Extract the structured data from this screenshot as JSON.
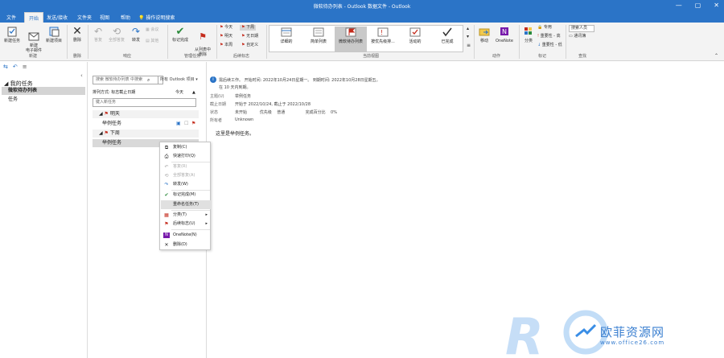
{
  "window": {
    "title": "微软待办列表 - Outlook 数据文件 - Outlook",
    "controls": [
      "—",
      "▢",
      "✕"
    ]
  },
  "menu": {
    "tabs": [
      "文件",
      "开始",
      "发送/接收",
      "文件夹",
      "视图",
      "帮助"
    ],
    "active_index": 1,
    "tell_me": "操作说明搜索"
  },
  "ribbon": {
    "new_group": {
      "label": "新建",
      "new_task": "新建任务",
      "new_email": "新建\n电子邮件",
      "new_items": "新建项目"
    },
    "delete_group": {
      "label": "删除",
      "delete": "删除"
    },
    "respond_group": {
      "label": "响应",
      "reply": "答复",
      "reply_all": "全部答复",
      "forward": "转发",
      "meeting": "会议",
      "more": "其他"
    },
    "manage_group": {
      "label": "管理任务",
      "mark_complete": "标记完成",
      "remove_from_list": "从列表中\n删除"
    },
    "followup_group": {
      "label": "后续标志",
      "items": [
        "今天",
        "明天",
        "本周",
        "下周",
        "无日期",
        "自定义"
      ]
    },
    "view_group": {
      "label": "当前视图",
      "views": [
        "详细的",
        "简单列表",
        "微软待办列表",
        "按优先级排...",
        "活动的",
        "已完成"
      ],
      "selected_index": 2
    },
    "actions_group": {
      "label": "动作",
      "move": "移动",
      "onenote": "OneNote"
    },
    "tags_group": {
      "label": "标记",
      "categorize": "分类",
      "private": "专用",
      "high": "重要性 - 高",
      "low": "重要性 - 低"
    },
    "find_group": {
      "label": "查找",
      "search_people": "搜索人员",
      "address_book": "通讯簿"
    }
  },
  "nav": {
    "header": "我的任务",
    "items": [
      "微软待办列表",
      "任务"
    ],
    "selected_index": 0
  },
  "list": {
    "search_placeholder": "搜索 微软待办列表 中搜索",
    "search_scope": "所有 Outlook 项目",
    "sort_label": "排列方式: 标志截止日期",
    "sort_value": "今天",
    "new_task_placeholder": "键入新任务",
    "groups": [
      {
        "name": "明天",
        "tasks": [
          "举例任务"
        ]
      },
      {
        "name": "下周",
        "tasks": [
          "举例任务"
        ]
      }
    ]
  },
  "context_menu": {
    "items": [
      {
        "label": "复制(C)",
        "icon": "copy-icon",
        "enabled": true
      },
      {
        "label": "快速打印(Q)",
        "icon": "print-icon",
        "enabled": true
      },
      {
        "label": "答复(R)",
        "icon": "reply-icon",
        "enabled": false
      },
      {
        "label": "全部答复(A)",
        "icon": "reply-all-icon",
        "enabled": false
      },
      {
        "label": "转发(W)",
        "icon": "forward-icon",
        "enabled": true
      },
      {
        "label": "标记完成(M)",
        "icon": "check-icon",
        "enabled": true
      },
      {
        "label": "重命名任务(T)",
        "icon": "",
        "enabled": true,
        "highlighted": true
      },
      {
        "label": "分类(T)",
        "icon": "categorize-icon",
        "enabled": true,
        "submenu": true
      },
      {
        "label": "后续标志(U)",
        "icon": "flag-icon",
        "enabled": true,
        "submenu": true
      },
      {
        "label": "OneNote(N)",
        "icon": "onenote-icon",
        "enabled": true
      },
      {
        "label": "删除(D)",
        "icon": "delete-icon",
        "enabled": true
      }
    ]
  },
  "reading_pane": {
    "info_line1": "需后续工作。  开始时间: 2022年10月24日星期一。  到期时间: 2022年10月28日星期五。",
    "info_line2": "在 10 天内到期。",
    "fields": [
      {
        "label": "主题(U)",
        "value": "举例任务"
      },
      {
        "label": "截止日期",
        "value": "开始于 2022/10/24,  截止于 2022/10/28"
      },
      {
        "label": "状态",
        "value": "未开始          优先级    普通                完成百分比    0%"
      },
      {
        "label": "所有者",
        "value": "Unknown"
      }
    ],
    "body": "这里是举例任务。"
  },
  "watermark": {
    "text": "欧菲资源网",
    "url": "www.office26.com"
  },
  "colors": {
    "accent": "#2b74c7",
    "flag": "#c42b1c",
    "onenote": "#7719aa",
    "watermark": "#8fbff0"
  }
}
